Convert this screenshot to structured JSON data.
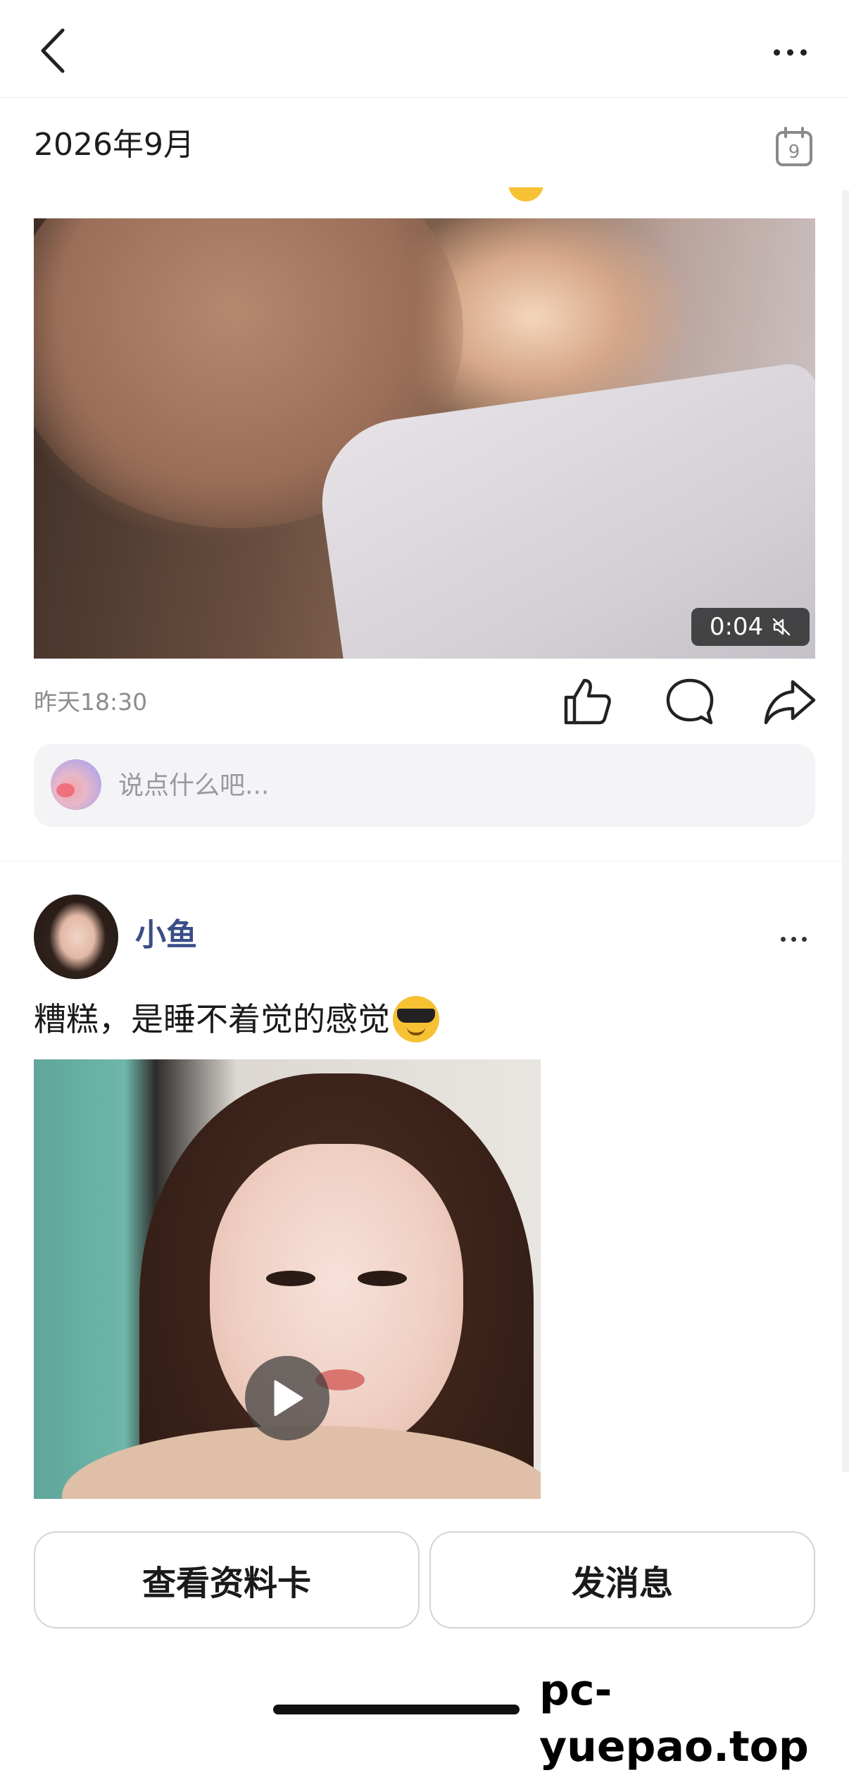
{
  "nav": {
    "back_icon": "chevron-left-icon",
    "more_icon": "more-horizontal-icon"
  },
  "date_bar": {
    "label": "2026年9月",
    "calendar_icon": "calendar-icon",
    "calendar_day": "9"
  },
  "post1": {
    "media_type": "video",
    "duration": "0:04",
    "muted_icon": "muted-speaker-icon",
    "time": "昨天18:30",
    "actions": [
      {
        "name": "like",
        "icon": "thumbs-up-icon"
      },
      {
        "name": "comment",
        "icon": "comment-bubble-icon"
      },
      {
        "name": "share",
        "icon": "share-arrow-icon"
      }
    ],
    "comment_placeholder": "说点什么吧..."
  },
  "post2": {
    "username": "小鱼",
    "text": "糟糕，是睡不着觉的感觉",
    "emoji": "sunglasses-emoji",
    "media_type": "video",
    "play_icon": "play-icon",
    "more_icon": "more-horizontal-icon"
  },
  "bottom_actions": {
    "profile_label": "查看资料卡",
    "message_label": "发消息"
  },
  "watermark": "pc-yuepao.top",
  "colors": {
    "username": "#3a4d86",
    "muted_text": "#8c8c8c",
    "comment_bg": "#f4f4f6",
    "border": "#d4d4d8"
  }
}
